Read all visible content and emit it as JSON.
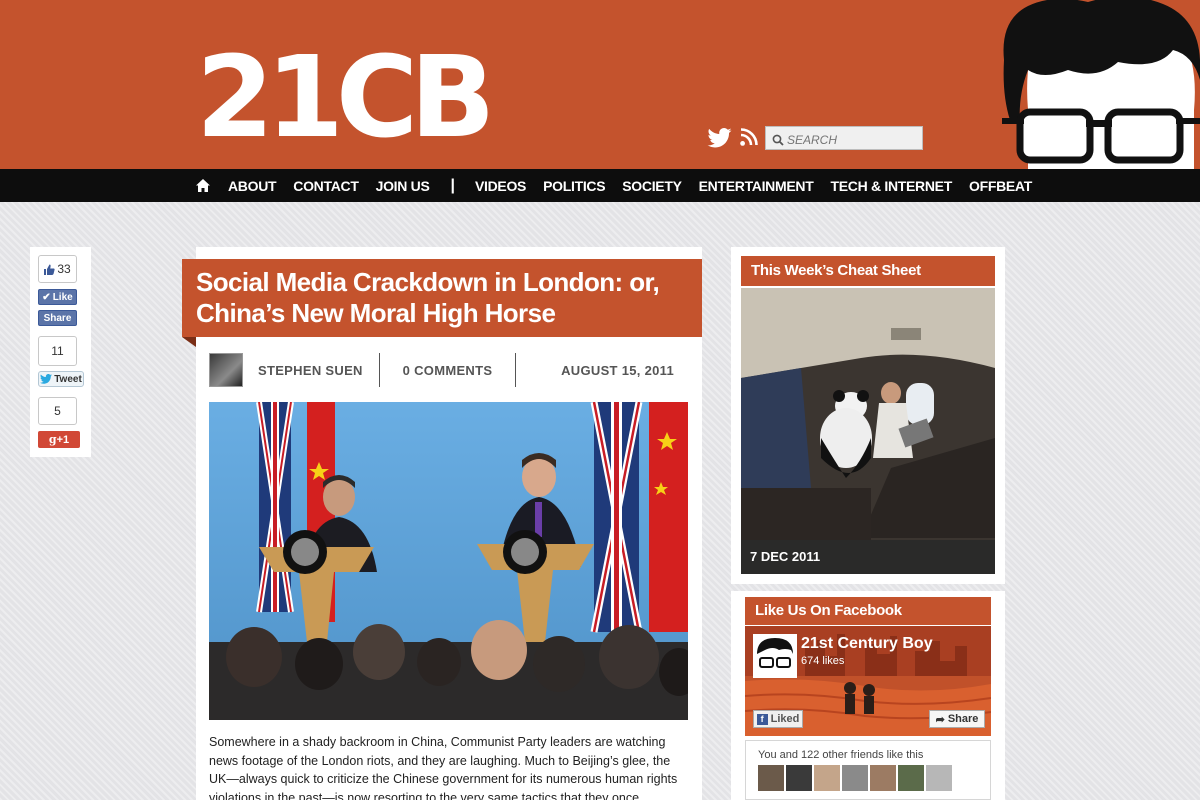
{
  "site": {
    "logo": "21CB"
  },
  "header": {
    "search_placeholder": "SEARCH",
    "twitter_icon": "twitter-bird-icon",
    "rss_icon": "rss-icon",
    "accent": "#c4532d"
  },
  "nav": {
    "home_icon": "home-icon",
    "items": [
      "ABOUT",
      "CONTACT",
      "JOIN US",
      "VIDEOS",
      "POLITICS",
      "SOCIETY",
      "ENTERTAINMENT",
      "TECH & INTERNET",
      "OFFBEAT"
    ],
    "separator": "|"
  },
  "share": {
    "fb_count": "33",
    "fb_like": "Like",
    "fb_share": "Share",
    "tw_count": "11",
    "tw_button": "Tweet",
    "gp_count": "5",
    "gp_button": "+1"
  },
  "article": {
    "title": "Social Media Crackdown in London: or, China’s New Moral High Horse",
    "author": "STEPHEN SUEN",
    "comments": "0 COMMENTS",
    "date": "AUGUST 15, 2011",
    "body": "Somewhere in a shady backroom in China, Communist Party leaders are watching news footage of the London riots, and they are laughing. Much to Beijing’s glee, the UK—always quick to criticize the Chinese government for its numerous human rights violations in the past—is now resorting to the very same tactics that they once condemned. Prime Minister"
  },
  "sidebar": {
    "cheat_sheet_title": "This Week’s Cheat Sheet",
    "cheat_sheet_date": "7 DEC 2011",
    "facebook_title": "Like Us On Facebook",
    "fb_page_name": "21st Century Boy",
    "fb_page_likes": "674 likes",
    "fb_liked_label": "Liked",
    "fb_share_label": "Share",
    "fb_friends_text": "You and 122 other friends like this"
  }
}
